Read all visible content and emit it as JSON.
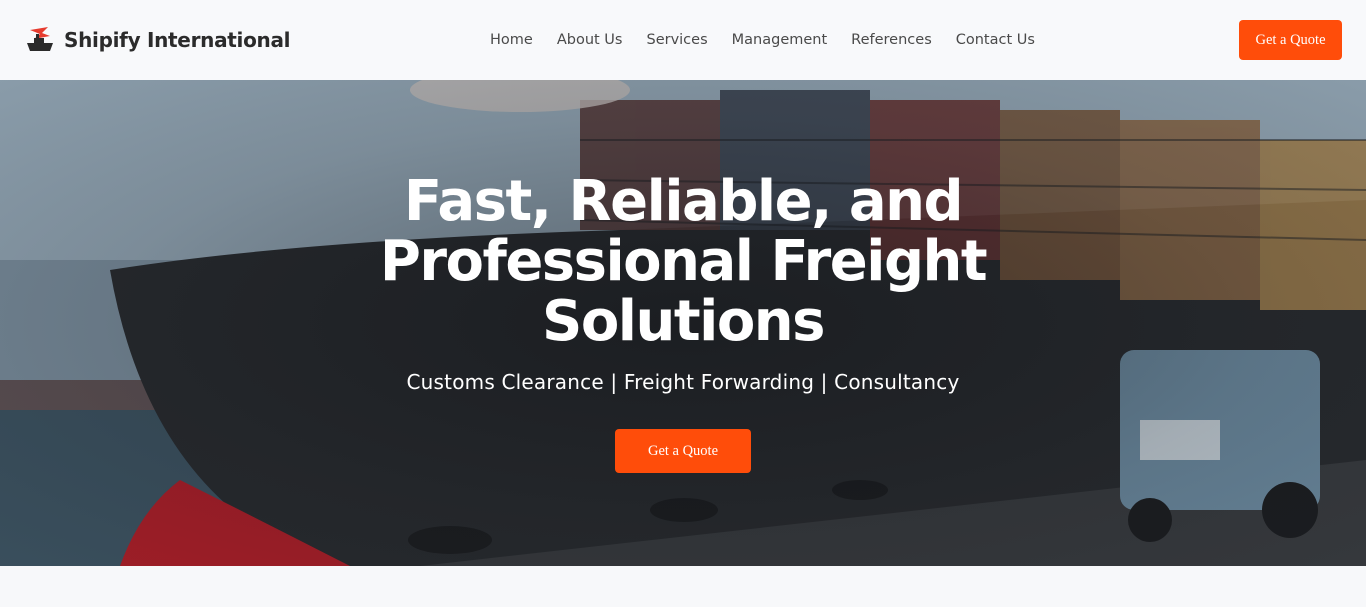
{
  "brand": {
    "name": "Shipify International",
    "logo_icon": "ship-logo-icon",
    "accent": "#e63b2e"
  },
  "nav": {
    "items": [
      {
        "label": "Home"
      },
      {
        "label": "About Us"
      },
      {
        "label": "Services"
      },
      {
        "label": "Management"
      },
      {
        "label": "References"
      },
      {
        "label": "Contact Us"
      }
    ]
  },
  "header": {
    "cta_label": "Get a Quote"
  },
  "hero": {
    "title": "Fast, Reliable, and Professional Freight Solutions",
    "subtitle": "Customs Clearance | Freight Forwarding | Consultancy",
    "cta_label": "Get a Quote"
  },
  "colors": {
    "primary_cta": "#ff4d0a",
    "header_bg": "#f8f9fb",
    "text_dark": "#2b2b2b"
  }
}
